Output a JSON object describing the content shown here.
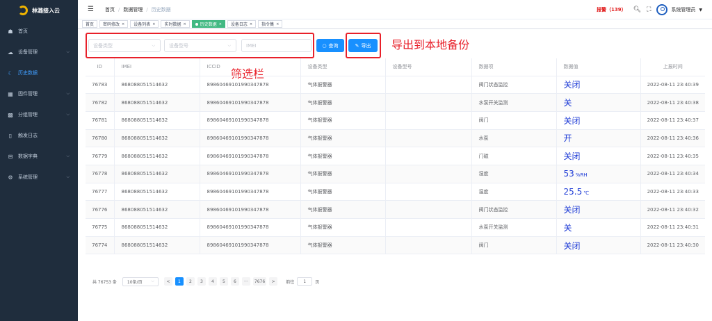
{
  "sidebar": {
    "logo_text": "林潞接入云",
    "items": [
      {
        "label": "首页",
        "icon": "dashboard-icon",
        "glyph": "☗",
        "arrow": false
      },
      {
        "label": "设备管理",
        "icon": "cloud-icon",
        "glyph": "☁",
        "arrow": true
      },
      {
        "label": "历史数据",
        "icon": "moon-icon",
        "glyph": "☾",
        "arrow": false
      },
      {
        "label": "固件管理",
        "icon": "layers-icon",
        "glyph": "▦",
        "arrow": true
      },
      {
        "label": "分组管理",
        "icon": "grid-icon",
        "glyph": "▩",
        "arrow": true
      },
      {
        "label": "触发日志",
        "icon": "document-icon",
        "glyph": "▯",
        "arrow": false
      },
      {
        "label": "数据字典",
        "icon": "briefcase-icon",
        "glyph": "⊟",
        "arrow": true
      },
      {
        "label": "系统管理",
        "icon": "gear-icon",
        "glyph": "⚙",
        "arrow": true
      }
    ]
  },
  "header": {
    "breadcrumb": [
      "首页",
      "数据管理",
      "历史数据"
    ],
    "alarm": "报警（139）",
    "username": "系统管理员"
  },
  "tags": [
    {
      "label": "首页",
      "closable": false,
      "active": false
    },
    {
      "label": "密码修改",
      "closable": true,
      "active": false
    },
    {
      "label": "设备列表",
      "closable": true,
      "active": false
    },
    {
      "label": "实时数据",
      "closable": true,
      "active": false
    },
    {
      "label": "历史数据",
      "closable": true,
      "active": true
    },
    {
      "label": "设备日志",
      "closable": true,
      "active": false
    },
    {
      "label": "指令集",
      "closable": true,
      "active": false
    }
  ],
  "filter": {
    "device_type_placeholder": "设备类型",
    "device_model_placeholder": "设备型号",
    "imei_placeholder": "IMEI",
    "search_label": "查询",
    "export_label": "导出"
  },
  "annotations": {
    "export_note": "导出到本地备份",
    "filter_note": "筛选栏"
  },
  "table": {
    "columns": [
      "ID",
      "IMEI",
      "ICCID",
      "设备类型",
      "设备型号",
      "数据项",
      "数据值",
      "上报时间"
    ],
    "rows": [
      {
        "id": "76783",
        "imei": "868088051514632",
        "iccid": "89860469101990347878",
        "type": "气体报警器",
        "model": "",
        "item": "阀门状态监控",
        "value": "关闭",
        "unit": "",
        "time": "2022-08-11 23:40:39"
      },
      {
        "id": "76782",
        "imei": "868088051514632",
        "iccid": "89860469101990347878",
        "type": "气体报警器",
        "model": "",
        "item": "水泵开关监测",
        "value": "关",
        "unit": "",
        "time": "2022-08-11 23:40:38"
      },
      {
        "id": "76781",
        "imei": "868088051514632",
        "iccid": "89860469101990347878",
        "type": "气体报警器",
        "model": "",
        "item": "阀门",
        "value": "关闭",
        "unit": "",
        "time": "2022-08-11 23:40:37"
      },
      {
        "id": "76780",
        "imei": "868088051514632",
        "iccid": "89860469101990347878",
        "type": "气体报警器",
        "model": "",
        "item": "水泵",
        "value": "开",
        "unit": "",
        "time": "2022-08-11 23:40:36"
      },
      {
        "id": "76779",
        "imei": "868088051514632",
        "iccid": "89860469101990347878",
        "type": "气体报警器",
        "model": "",
        "item": "门磁",
        "value": "关闭",
        "unit": "",
        "time": "2022-08-11 23:40:35"
      },
      {
        "id": "76778",
        "imei": "868088051514632",
        "iccid": "89860469101990347878",
        "type": "气体报警器",
        "model": "",
        "item": "湿度",
        "value": "53",
        "unit": "%RH",
        "time": "2022-08-11 23:40:34"
      },
      {
        "id": "76777",
        "imei": "868088051514632",
        "iccid": "89860469101990347878",
        "type": "气体报警器",
        "model": "",
        "item": "温度",
        "value": "25.5",
        "unit": "℃",
        "time": "2022-08-11 23:40:33"
      },
      {
        "id": "76776",
        "imei": "868088051514632",
        "iccid": "89860469101990347878",
        "type": "气体报警器",
        "model": "",
        "item": "阀门状态监控",
        "value": "关闭",
        "unit": "",
        "time": "2022-08-11 23:40:32"
      },
      {
        "id": "76775",
        "imei": "868088051514632",
        "iccid": "89860469101990347878",
        "type": "气体报警器",
        "model": "",
        "item": "水泵开关监测",
        "value": "关",
        "unit": "",
        "time": "2022-08-11 23:40:31"
      },
      {
        "id": "76774",
        "imei": "868088051514632",
        "iccid": "89860469101990347878",
        "type": "气体报警器",
        "model": "",
        "item": "阀门",
        "value": "关闭",
        "unit": "",
        "time": "2022-08-11 23:40:30"
      }
    ]
  },
  "pagination": {
    "total": "共 76753 条",
    "page_size": "10条/页",
    "prev": "<",
    "pages": [
      "1",
      "2",
      "3",
      "4",
      "5",
      "6",
      "···",
      "7676"
    ],
    "next": ">",
    "goto_label": "前往",
    "goto_value": "1",
    "page_suffix": "页"
  },
  "colors": {
    "accent": "#1890ff",
    "sidebar": "#1f2d3d",
    "annotation": "#e8202a",
    "active_tag": "#42b983"
  }
}
